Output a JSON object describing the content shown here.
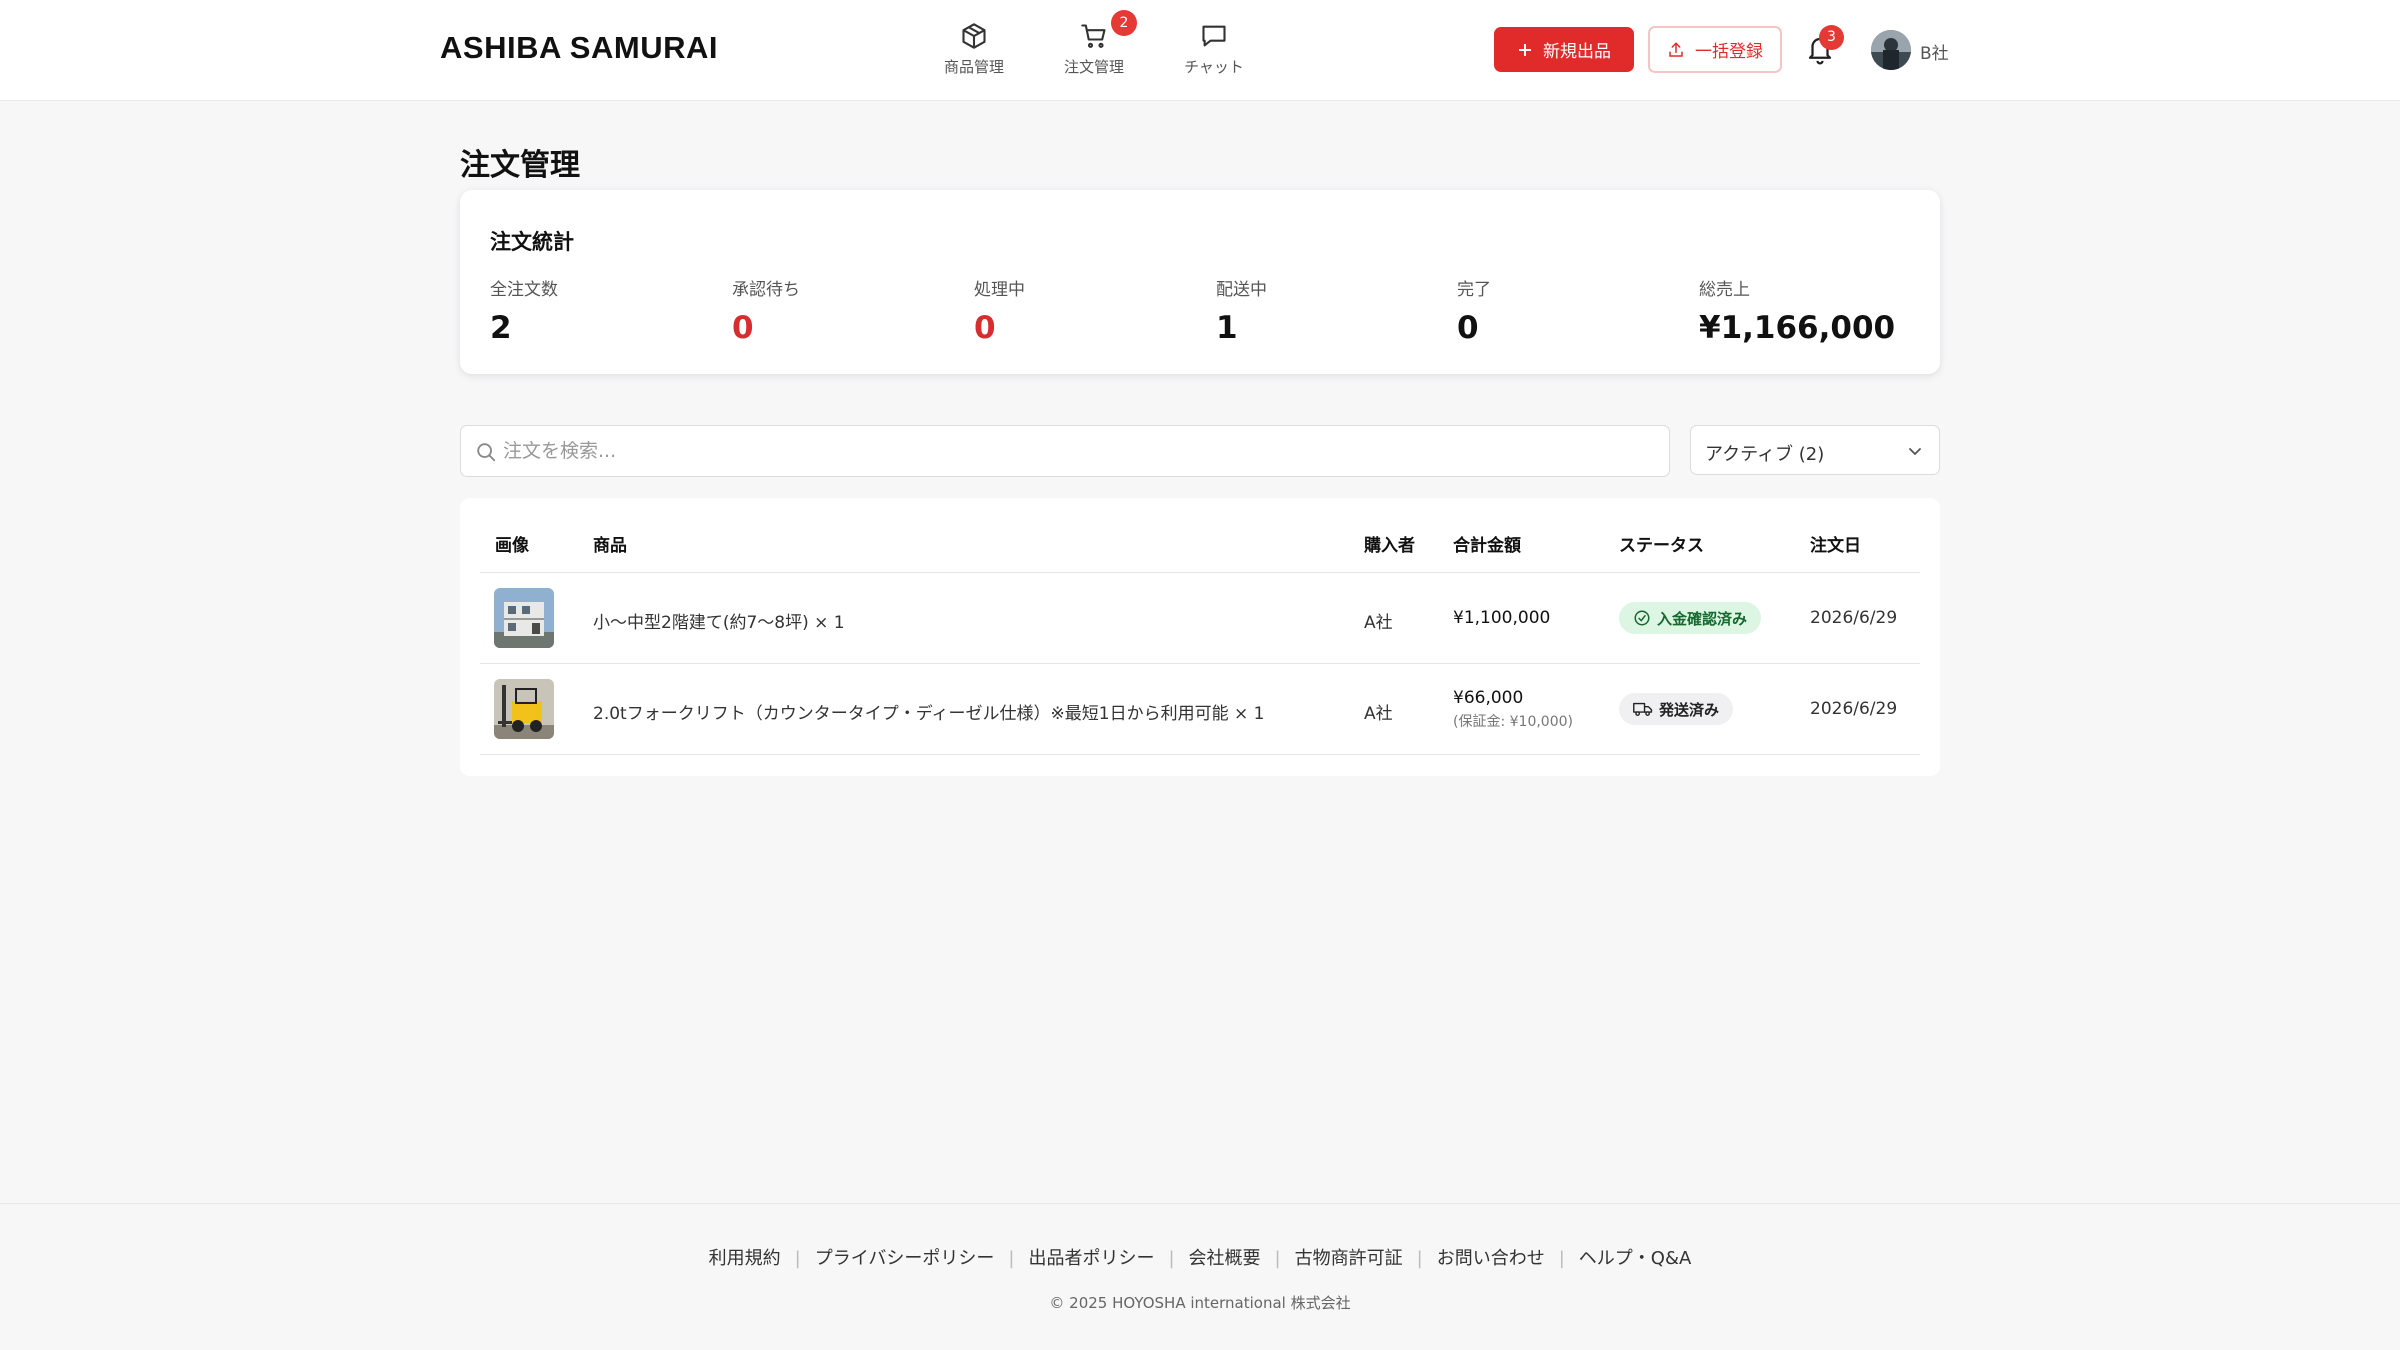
{
  "header": {
    "logo": "ASHIBA SAMURAI",
    "nav": [
      {
        "label": "商品管理",
        "icon": "box-icon"
      },
      {
        "label": "注文管理",
        "icon": "cart-icon",
        "badge": "2"
      },
      {
        "label": "チャット",
        "icon": "chat-icon"
      }
    ],
    "new_listing": "新規出品",
    "bulk_register": "一括登録",
    "notifications_badge": "3",
    "user_name": "B社"
  },
  "page": {
    "title": "注文管理"
  },
  "stats": {
    "title": "注文統計",
    "items": [
      {
        "label": "全注文数",
        "value": "2"
      },
      {
        "label": "承認待ち",
        "value": "0"
      },
      {
        "label": "処理中",
        "value": "0"
      },
      {
        "label": "配送中",
        "value": "1"
      },
      {
        "label": "完了",
        "value": "0"
      },
      {
        "label": "総売上",
        "value": "¥1,166,000"
      }
    ]
  },
  "search": {
    "placeholder": "注文を検索..."
  },
  "filter": {
    "selected": "アクティブ (2)"
  },
  "table": {
    "headers": [
      "画像",
      "商品",
      "購入者",
      "合計金額",
      "ステータス",
      "注文日"
    ],
    "rows": [
      {
        "product": "小〜中型2階建て(約7〜8坪) × 1",
        "buyer": "A社",
        "total": "¥1,100,000",
        "status": "入金確認済み",
        "date": "2026/6/29"
      },
      {
        "product": "2.0tフォークリフト（カウンタータイプ・ディーゼル仕様）※最短1日から利用可能 × 1",
        "buyer": "A社",
        "total": "¥66,000",
        "deposit": "(保証金: ¥10,000)",
        "status": "発送済み",
        "date": "2026/6/29"
      }
    ]
  },
  "footer": {
    "links": [
      "利用規約",
      "プライバシーポリシー",
      "出品者ポリシー",
      "会社概要",
      "古物商許可証",
      "お問い合わせ",
      "ヘルプ・Q&A"
    ],
    "copyright": "© 2025 HOYOSHA international 株式会社"
  },
  "colors": {
    "accent": "#e12b2b",
    "status_green_bg": "#dcf6e3",
    "status_gray_bg": "#f0f0f2"
  }
}
